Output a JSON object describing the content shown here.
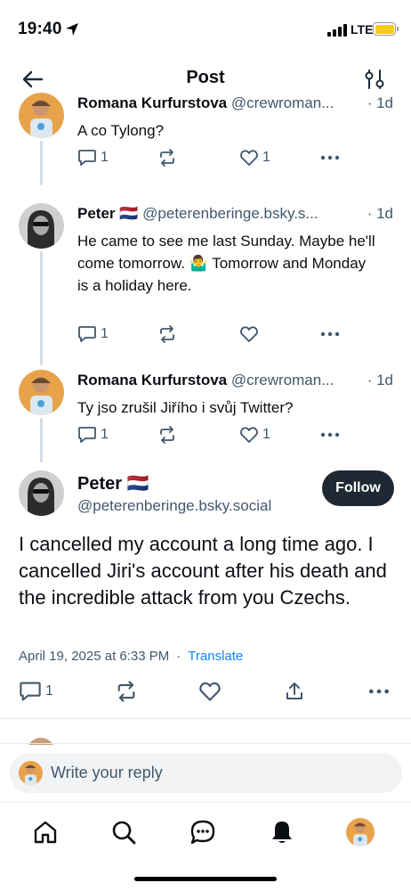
{
  "status_bar": {
    "time": "19:40",
    "network": "LTE"
  },
  "header": {
    "title": "Post"
  },
  "replies": [
    {
      "name": "Romana Kurfurstova",
      "flag": "",
      "handle": "@crewroman...",
      "time": "· 1d",
      "text": "A co Tylong?",
      "reply_count": "1",
      "repost_count": "",
      "like_count": "1"
    },
    {
      "name": "Peter",
      "flag": "🇳🇱",
      "handle": "@peterenberinge.bsky.s...",
      "time": "· 1d",
      "text": "He came to see me last Sunday. Maybe he'll come tomorrow. 🤷‍♂️ Tomorrow and Monday is a holiday here.",
      "reply_count": "1",
      "repost_count": "",
      "like_count": ""
    },
    {
      "name": "Romana Kurfurstova",
      "flag": "",
      "handle": "@crewroman...",
      "time": "· 1d",
      "text": "Ty jso zrušil Jiřího i svůj Twitter?",
      "reply_count": "1",
      "repost_count": "",
      "like_count": "1"
    }
  ],
  "main_post": {
    "name": "Peter",
    "flag": "🇳🇱",
    "handle": "@peterenberinge.bsky.social",
    "follow_label": "Follow",
    "text": "I cancelled my account a long time ago. I cancelled Jiri's account after his death and the incredible attack from you Czechs.",
    "date": "April 19, 2025 at 6:33 PM",
    "separator": "·",
    "translate_label": "Translate",
    "reply_count": "1"
  },
  "composer": {
    "placeholder": "Write your reply"
  },
  "icons": {
    "back": "arrow-left-icon",
    "filter": "sliders-icon",
    "reply": "speech-bubble-icon",
    "repost": "repost-arrows-icon",
    "like": "heart-icon",
    "more": "ellipsis-icon",
    "share": "share-icon",
    "home": "home-icon",
    "search": "search-icon",
    "chat": "chat-icon",
    "notifications": "bell-icon"
  },
  "colors": {
    "accent": "#1083fe",
    "muted_text": "#42576c",
    "follow_button": "#1f2933",
    "battery": "#f5cc1d"
  }
}
